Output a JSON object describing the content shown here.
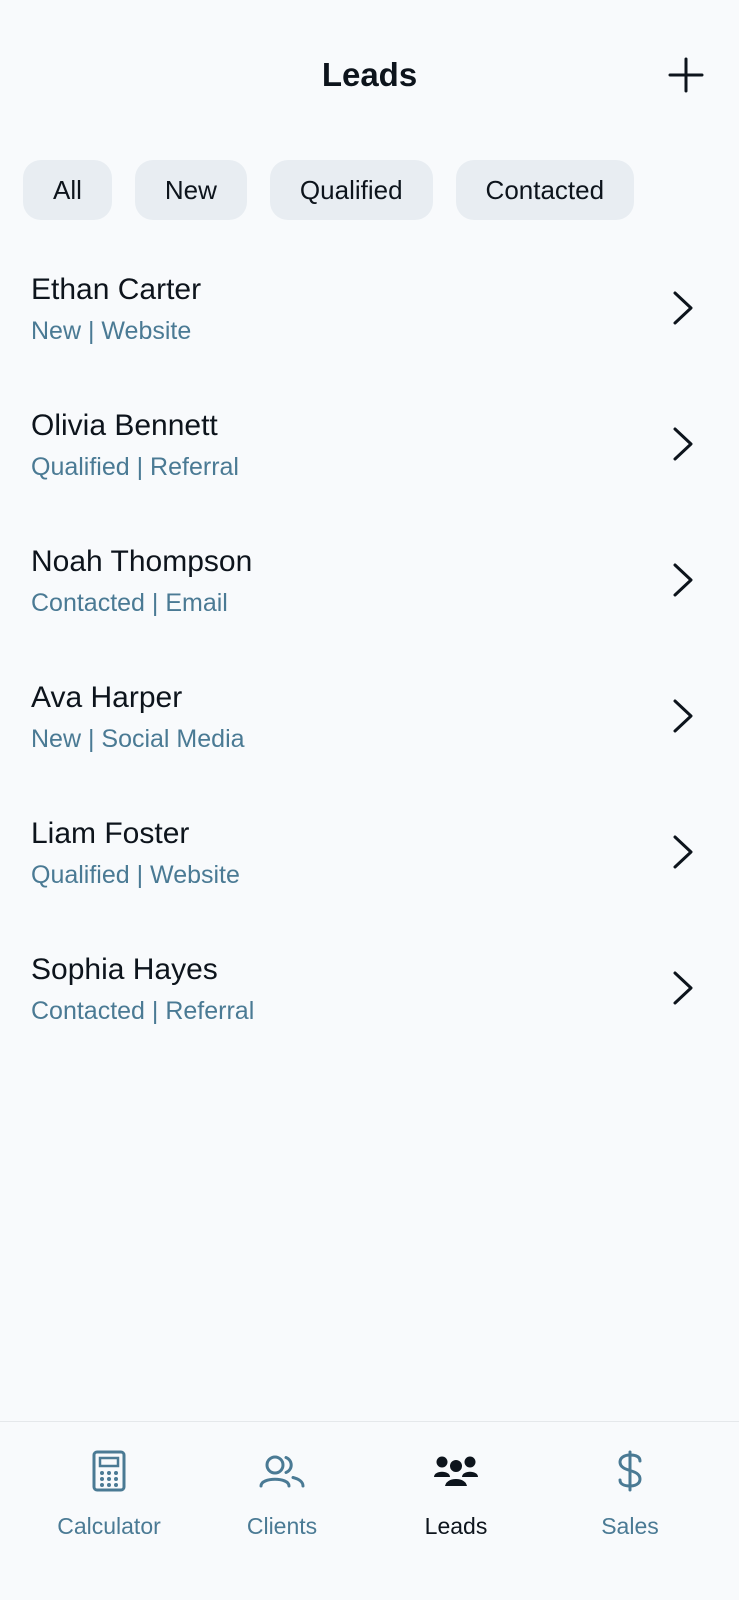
{
  "header": {
    "title": "Leads",
    "add_icon": "plus-icon"
  },
  "filters": [
    {
      "label": "All"
    },
    {
      "label": "New"
    },
    {
      "label": "Qualified"
    },
    {
      "label": "Contacted"
    }
  ],
  "leads": [
    {
      "name": "Ethan Carter",
      "meta": "New | Website"
    },
    {
      "name": "Olivia Bennett",
      "meta": "Qualified | Referral"
    },
    {
      "name": "Noah Thompson",
      "meta": "Contacted | Email"
    },
    {
      "name": "Ava Harper",
      "meta": "New | Social Media"
    },
    {
      "name": "Liam Foster",
      "meta": "Qualified | Website"
    },
    {
      "name": "Sophia Hayes",
      "meta": "Contacted | Referral"
    }
  ],
  "tabs": [
    {
      "label": "Calculator",
      "icon": "calculator-icon",
      "active": false
    },
    {
      "label": "Clients",
      "icon": "users-icon",
      "active": false
    },
    {
      "label": "Leads",
      "icon": "users-filled-icon",
      "active": true
    },
    {
      "label": "Sales",
      "icon": "dollar-icon",
      "active": false
    }
  ],
  "colors": {
    "background": "#F8FAFC",
    "chip": "#E8EDF2",
    "text_primary": "#0D141C",
    "text_secondary": "#4A7A94"
  }
}
